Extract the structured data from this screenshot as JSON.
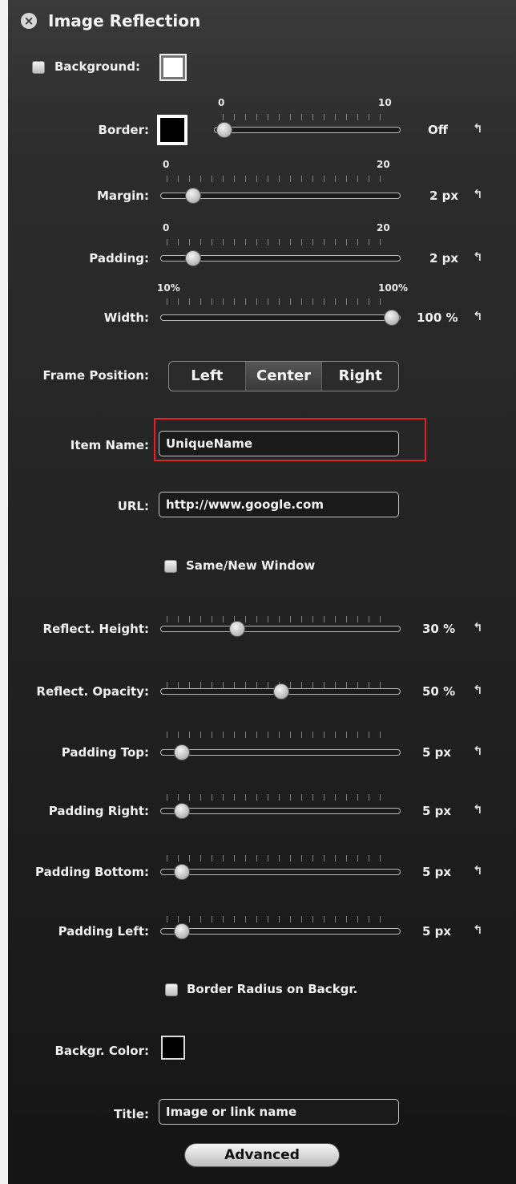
{
  "panel": {
    "title": "Image Reflection",
    "close_icon": "close-icon"
  },
  "background": {
    "checked": false,
    "label": "Background:",
    "color": "#ffffff"
  },
  "border": {
    "label": "Border:",
    "color": "#000000",
    "min": "0",
    "max": "10",
    "value": 0,
    "value_text": "Off"
  },
  "margin": {
    "label": "Margin:",
    "min": "0",
    "max": "20",
    "value": 2,
    "value_text": "2 px"
  },
  "padding": {
    "label": "Padding:",
    "min": "0",
    "max": "20",
    "value": 2,
    "value_text": "2 px"
  },
  "width": {
    "label": "Width:",
    "min": "10%",
    "max": "100%",
    "value": 100,
    "value_text": "100 %"
  },
  "frame_position": {
    "label": "Frame Position:",
    "options": [
      "Left",
      "Center",
      "Right"
    ],
    "selected": "Center"
  },
  "item_name": {
    "label": "Item Name:",
    "value": "UniqueName"
  },
  "url": {
    "label": "URL:",
    "value": "http://www.google.com"
  },
  "same_new_window": {
    "label": "Same/New Window",
    "checked": false
  },
  "reflect_height": {
    "label": "Reflect. Height:",
    "value": 30,
    "value_text": "30 %"
  },
  "reflect_opacity": {
    "label": "Reflect. Opacity:",
    "value": 50,
    "value_text": "50 %"
  },
  "padding_top": {
    "label": "Padding Top:",
    "value": 5,
    "value_text": "5 px"
  },
  "padding_right": {
    "label": "Padding Right:",
    "value": 5,
    "value_text": "5 px"
  },
  "padding_bottom": {
    "label": "Padding Bottom:",
    "value": 5,
    "value_text": "5 px"
  },
  "padding_left": {
    "label": "Padding Left:",
    "value": 5,
    "value_text": "5 px"
  },
  "border_radius": {
    "label": "Border Radius on Backgr.",
    "checked": false
  },
  "backgr_color": {
    "label": "Backgr. Color:",
    "color": "#000000"
  },
  "title_field": {
    "label": "Title:",
    "value": "Image or link name"
  },
  "advanced": {
    "label": "Advanced"
  },
  "reset_icon": "reset-arrow-icon",
  "accent": {
    "highlight": "#e0232b"
  }
}
